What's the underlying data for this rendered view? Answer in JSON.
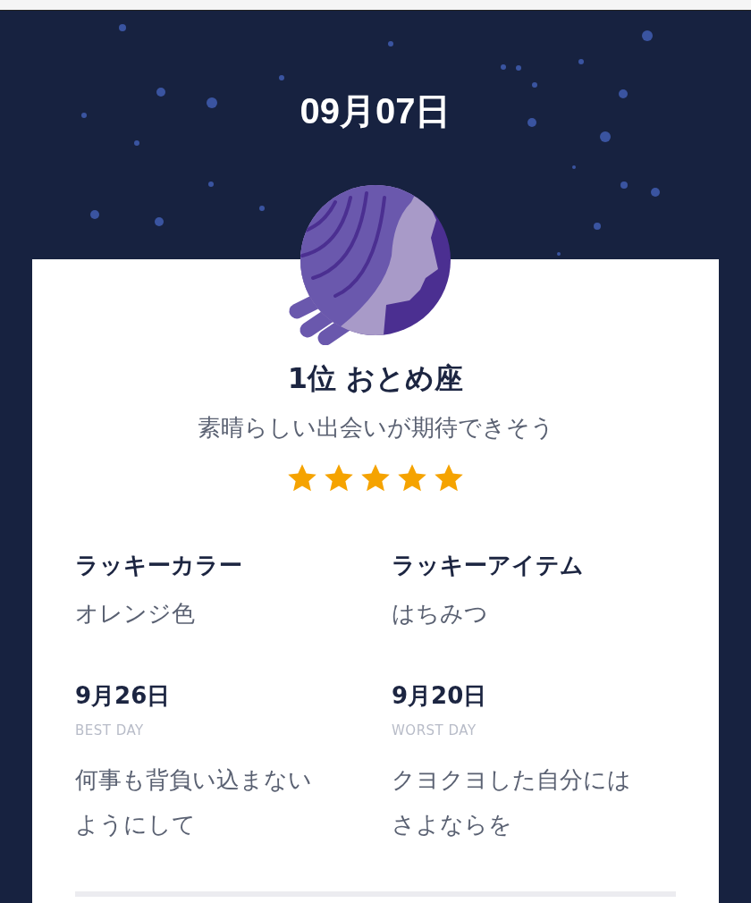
{
  "date": "09月07日",
  "ranking": {
    "title": "1位 おとめ座",
    "message": "素晴らしい出会いが期待できそう",
    "stars": 5
  },
  "lucky": [
    {
      "label": "ラッキーカラー",
      "value": "オレンジ色"
    },
    {
      "label": "ラッキーアイテム",
      "value": "はちみつ"
    }
  ],
  "days": [
    {
      "date": "9月26日",
      "caption": "BEST DAY",
      "advice": "何事も背負い込まないようにして"
    },
    {
      "date": "9月20日",
      "caption": "WORST DAY",
      "advice": "クヨクヨした自分にはさよならを"
    }
  ]
}
